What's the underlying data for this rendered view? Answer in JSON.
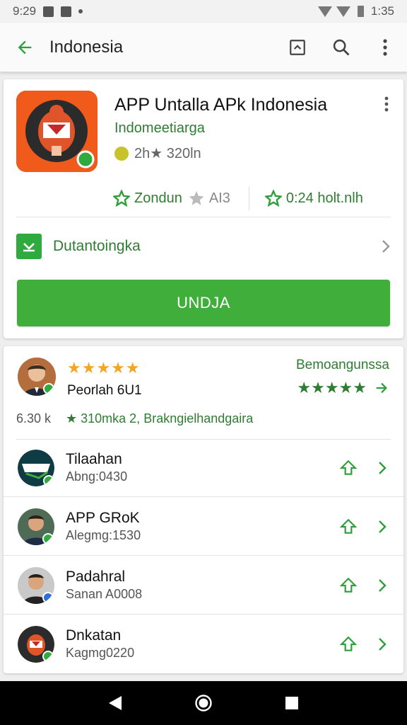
{
  "status_bar": {
    "time": "9:29",
    "right_time": "1:35"
  },
  "app_bar": {
    "title": "Indonesia"
  },
  "app": {
    "name": "APP Untalla APk Indonesia",
    "developer": "Indomeetiarga",
    "meta": "2h★ 320ln",
    "stat_a_label": "Zondun",
    "stat_b_label": "AI3",
    "stat_c_label": "0:24 holt.nlh",
    "install_row_label": "Dutantoingka",
    "install_button": "UNDJA"
  },
  "review": {
    "stars": "★★★★★",
    "name": "Peorlah 6U1",
    "right_label": "Bemoangunssa",
    "right_stars": "★★★★★",
    "count": "6.30 k",
    "summary": "★ 310mka 2, Brakngielhandgaira"
  },
  "list": [
    {
      "title": "Tilaahan",
      "sub": "Abng:0430",
      "avatar": "dad-logo"
    },
    {
      "title": "APP GRoK",
      "sub": "Alegmg:1530",
      "avatar": "person"
    },
    {
      "title": "Padahral",
      "sub": "Sanan A0008",
      "avatar": "person"
    },
    {
      "title": "Dnkatan",
      "sub": "Kagmg0220",
      "avatar": "app-logo"
    }
  ],
  "colors": {
    "accent": "#3fae3a",
    "accent_dark": "#2e7d32",
    "app_icon": "#f05a1a",
    "star": "#f4a623"
  }
}
